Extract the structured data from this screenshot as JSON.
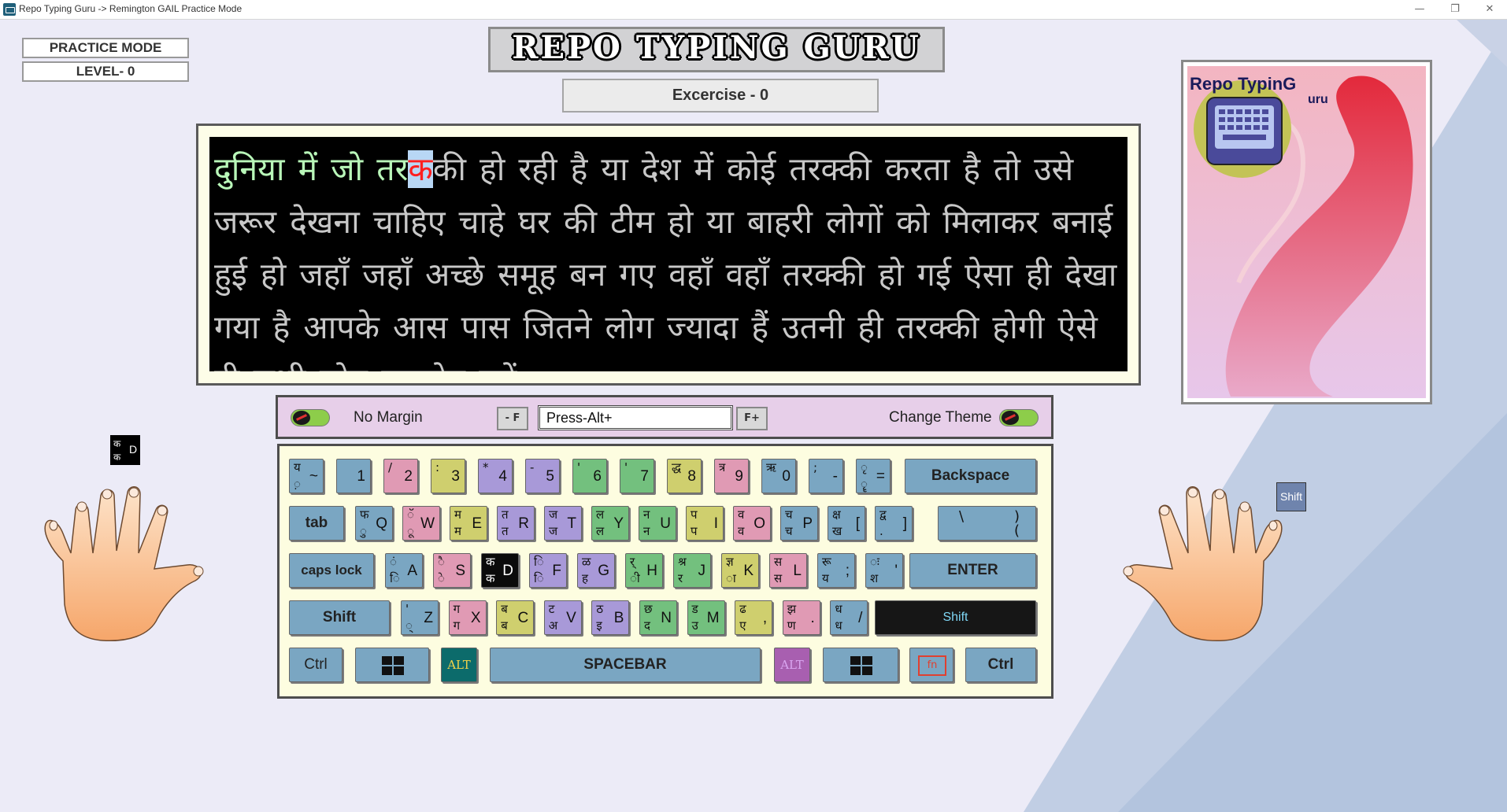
{
  "window": {
    "title": "Repo Typing Guru -> Remington GAIL Practice Mode",
    "minimize": "—",
    "maximize": "❐",
    "close": "✕"
  },
  "status": {
    "mode": "PRACTICE MODE",
    "level": "LEVEL- 0"
  },
  "header": {
    "app_title": "REPO TYPING GURU",
    "exercise": "Excercise - 0"
  },
  "passage": {
    "typed": "दुनिया में जो तर",
    "current": "क",
    "remaining": "की हो रही है या देश में कोई तरक्की करता है तो उसे जरूर देखना चाहिए चाहे घर की टीम हो या बाहरी लोगों को मिलाकर बनाई हुई हो जहाँ जहाँ अच्छे समूह बन गए वहाँ वहाँ तरक्की हो गई ऐसा ही देखा गया है आपके आस पास जितने लोग ज्यादा हैं उतनी ही तरक्की होगी ऐसे ही सभी लोग सहयोग करें"
  },
  "toolbar": {
    "no_margin": "No Margin",
    "font_minus": "- F",
    "font_plus": "F+",
    "alt_input_value": "Press-Alt+",
    "change_theme": "Change Theme"
  },
  "keyboard": {
    "row1": [
      {
        "hi": "य",
        "lo": "़",
        "en": "~",
        "color": "blue"
      },
      {
        "hi": "",
        "lo": "",
        "en": "1",
        "color": "blue"
      },
      {
        "hi": "/",
        "lo": "",
        "en": "2",
        "color": "pink"
      },
      {
        "hi": ":",
        "lo": "",
        "en": "3",
        "color": "yellow"
      },
      {
        "hi": "*",
        "lo": "",
        "en": "4",
        "color": "purple"
      },
      {
        "hi": "-",
        "lo": "",
        "en": "5",
        "color": "purple"
      },
      {
        "hi": "'",
        "lo": "",
        "en": "6",
        "color": "green"
      },
      {
        "hi": "'",
        "lo": "",
        "en": "7",
        "color": "green"
      },
      {
        "hi": "द्ध",
        "lo": "",
        "en": "8",
        "color": "yellow"
      },
      {
        "hi": "त्र",
        "lo": "",
        "en": "9",
        "color": "pink"
      },
      {
        "hi": "ऋ",
        "lo": "",
        "en": "0",
        "color": "blue"
      },
      {
        "hi": ";",
        "lo": "",
        "en": "-",
        "color": "blue"
      },
      {
        "hi": "ृ",
        "lo": "ॄ",
        "en": "=",
        "color": "blue"
      }
    ],
    "row2": [
      {
        "hi": "फ",
        "lo": "ु",
        "en": "Q",
        "color": "blue"
      },
      {
        "hi": "ॅ",
        "lo": "ू",
        "en": "W",
        "color": "pink"
      },
      {
        "hi": "म",
        "lo": "म",
        "en": "E",
        "color": "yellow"
      },
      {
        "hi": "त",
        "lo": "त",
        "en": "R",
        "color": "purple"
      },
      {
        "hi": "ज",
        "lo": "ज",
        "en": "T",
        "color": "purple"
      },
      {
        "hi": "ल",
        "lo": "ल",
        "en": "Y",
        "color": "green"
      },
      {
        "hi": "न",
        "lo": "न",
        "en": "U",
        "color": "green"
      },
      {
        "hi": "प",
        "lो": "",
        "lo": "प",
        "en": "I",
        "color": "yellow"
      },
      {
        "hi": "व",
        "lo": "व",
        "en": "O",
        "color": "pink"
      },
      {
        "hi": "च",
        "lo": "च",
        "en": "P",
        "color": "blue"
      },
      {
        "hi": "क्ष",
        "lo": "ख",
        "en": "[",
        "color": "blue"
      },
      {
        "hi": "द्व",
        "lo": ".",
        "en": "]",
        "color": "blue"
      }
    ],
    "backslash_key": {
      "top": "\\",
      "right_top": ")",
      "right_bottom": "("
    },
    "row3": [
      {
        "hi": "ं",
        "lo": "ि",
        "en": "A",
        "color": "blue"
      },
      {
        "hi": "ै",
        "lo": "े",
        "en": "S",
        "color": "pink"
      },
      {
        "hi": "क",
        "lo": "क",
        "en": "D",
        "color": "black"
      },
      {
        "hi": "ि",
        "lo": "ि",
        "en": "F",
        "color": "purple"
      },
      {
        "hi": "ळ",
        "lo": "ह",
        "en": "G",
        "color": "purple"
      },
      {
        "hi": "र्",
        "lo": "ी",
        "en": "H",
        "color": "green"
      },
      {
        "hi": "श्र",
        "lo": "र",
        "en": "J",
        "color": "green"
      },
      {
        "hi": "ज्ञ",
        "lo": "ा",
        "en": "K",
        "color": "yellow"
      },
      {
        "hi": "स",
        "lo": "स",
        "en": "L",
        "color": "pink"
      },
      {
        "hi": "रू",
        "lo": "य",
        "en": ";",
        "color": "blue"
      },
      {
        "hi": "ः",
        "lo": "श",
        "en": "'",
        "color": "blue"
      }
    ],
    "row4": [
      {
        "hi": "'",
        "lo": "्",
        "en": "Z",
        "color": "blue"
      },
      {
        "hi": "ग",
        "lo": "ग",
        "en": "X",
        "color": "pink"
      },
      {
        "hi": "ब",
        "lo": "ब",
        "en": "C",
        "color": "yellow"
      },
      {
        "hi": "ट",
        "lo": "अ",
        "en": "V",
        "color": "purple"
      },
      {
        "hi": "ठ",
        "lo": "इ",
        "en": "B",
        "color": "purple"
      },
      {
        "hi": "छ",
        "lo": "द",
        "en": "N",
        "color": "green"
      },
      {
        "hi": "ड",
        "lo": "उ",
        "en": "M",
        "color": "green"
      },
      {
        "hi": "ढ",
        "lo": "ए",
        "en": ",",
        "color": "yellow"
      },
      {
        "hi": "झ",
        "lo": "ण",
        "en": ".",
        "color": "pink"
      },
      {
        "hi": "ध",
        "lo": "ध",
        "en": "/",
        "color": "blue"
      }
    ],
    "labels": {
      "backspace": "Backspace",
      "tab": "tab",
      "caps": "caps lock",
      "enter": "ENTER",
      "shift_left": "Shift",
      "shift_right": "Shift",
      "ctrl_left": "Ctrl",
      "ctrl_right": "Ctrl",
      "alt_left": "ALT",
      "alt_right": "ALT",
      "space": "SPACEBAR",
      "fn": "fn"
    }
  },
  "hint": {
    "left_key_hi": "क",
    "left_key_lo": "क",
    "left_key_en": "D",
    "right_key": "Shift"
  },
  "brand": {
    "logo_text": "Repo TypinG",
    "logo_sub": "uru"
  },
  "colors": {
    "blue": "#7aa6c2",
    "pink": "#e09ab4",
    "yellow": "#cfcf6e",
    "purple": "#a899d8",
    "green": "#73c07e",
    "highlight": "#000000",
    "typed_text": "#b9f7b9",
    "cursor_char": "#ff2020"
  }
}
